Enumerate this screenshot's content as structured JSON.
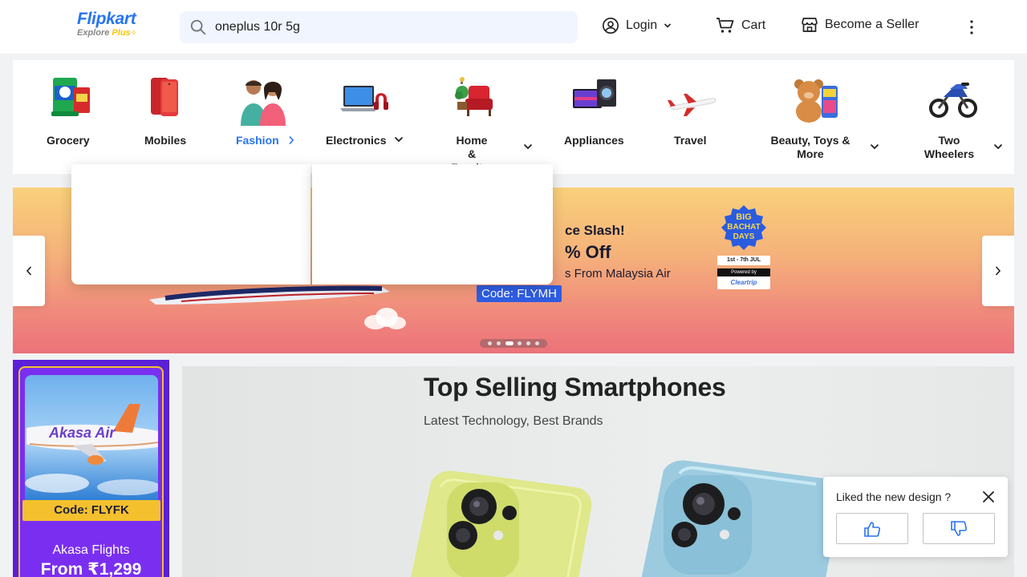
{
  "header": {
    "logo_main": "Flipkart",
    "logo_sub_explore": "Explore",
    "logo_sub_plus": "Plus",
    "search_value": "oneplus 10r 5g",
    "login_label": "Login",
    "cart_label": "Cart",
    "seller_label": "Become a Seller",
    "brand_color": "#2874f0"
  },
  "categories": [
    {
      "label": "Grocery"
    },
    {
      "label": "Mobiles"
    },
    {
      "label": "Fashion"
    },
    {
      "label": "Electronics"
    },
    {
      "label": "Home &",
      "label2": "Furniture"
    },
    {
      "label": "Appliances"
    },
    {
      "label": "Travel"
    },
    {
      "label": "Beauty, Toys &",
      "label2": "More"
    },
    {
      "label": "Two",
      "label2": "Wheelers"
    }
  ],
  "carousel": {
    "promo_title": "ce Slash!",
    "promo_off": "% Off",
    "promo_sub": "s From Malaysia Air",
    "promo_code": "Code: FLYMH",
    "badge_line1": "BIG",
    "badge_line2": "BACHAT",
    "badge_line3": "DAYS",
    "badge_date": "1st - 7th JUL",
    "badge_powered": "Powered by",
    "badge_brand": "Cleartrip"
  },
  "left_ad": {
    "airline": "Akasa Air",
    "code": "Code: FLYFK",
    "title": "Akasa Flights",
    "price": "From ₹1,299"
  },
  "banner": {
    "title": "Top Selling Smartphones",
    "subtitle": "Latest Technology, Best Brands"
  },
  "feedback": {
    "question": "Liked the new design ?"
  }
}
